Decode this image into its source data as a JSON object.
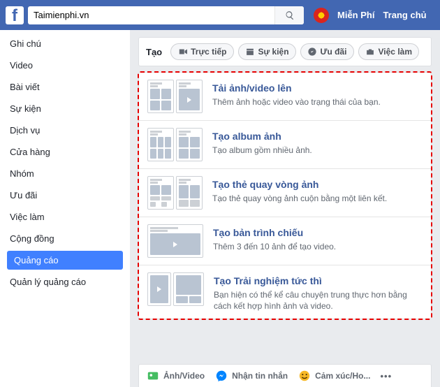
{
  "topbar": {
    "search_value": "Taimienphi.vn",
    "brand": "Miễn Phí",
    "home": "Trang chủ"
  },
  "sidebar": {
    "items": [
      {
        "label": "Ghi chú"
      },
      {
        "label": "Video"
      },
      {
        "label": "Bài viết"
      },
      {
        "label": "Sự kiện"
      },
      {
        "label": "Dịch vụ"
      },
      {
        "label": "Cửa hàng"
      },
      {
        "label": "Nhóm"
      },
      {
        "label": "Ưu đãi"
      },
      {
        "label": "Việc làm"
      },
      {
        "label": "Cộng đồng"
      },
      {
        "label": "Quảng cáo",
        "active": true
      },
      {
        "label": "Quản lý quảng cáo"
      }
    ]
  },
  "create": {
    "label": "Tạo",
    "chips": [
      {
        "label": "Trực tiếp",
        "icon": "video"
      },
      {
        "label": "Sự kiện",
        "icon": "calendar"
      },
      {
        "label": "Ưu đãi",
        "icon": "tag"
      },
      {
        "label": "Việc làm",
        "icon": "briefcase"
      }
    ]
  },
  "options": [
    {
      "title": "Tải ảnh/video lên",
      "desc": "Thêm ảnh hoặc video vào trạng thái của bạn.",
      "thumb": "upload"
    },
    {
      "title": "Tạo album ảnh",
      "desc": "Tạo album gồm nhiều ảnh.",
      "thumb": "album"
    },
    {
      "title": "Tạo thẻ quay vòng ảnh",
      "desc": "Tạo thẻ quay vòng ảnh cuộn bằng một liên kết.",
      "thumb": "carousel"
    },
    {
      "title": "Tạo bản trình chiếu",
      "desc": "Thêm 3 đến 10 ảnh để tạo video.",
      "thumb": "slideshow"
    },
    {
      "title": "Tạo Trải nghiệm tức thì",
      "desc": "Bạn hiện có thể kể câu chuyện trung thực hơn bằng cách kết hợp hình ảnh và video.",
      "thumb": "instant"
    }
  ],
  "footer": {
    "tabs": [
      {
        "label": "Ảnh/Video",
        "icon": "photo"
      },
      {
        "label": "Nhận tin nhắn",
        "icon": "messenger"
      },
      {
        "label": "Cảm xúc/Ho...",
        "icon": "smile"
      }
    ]
  }
}
